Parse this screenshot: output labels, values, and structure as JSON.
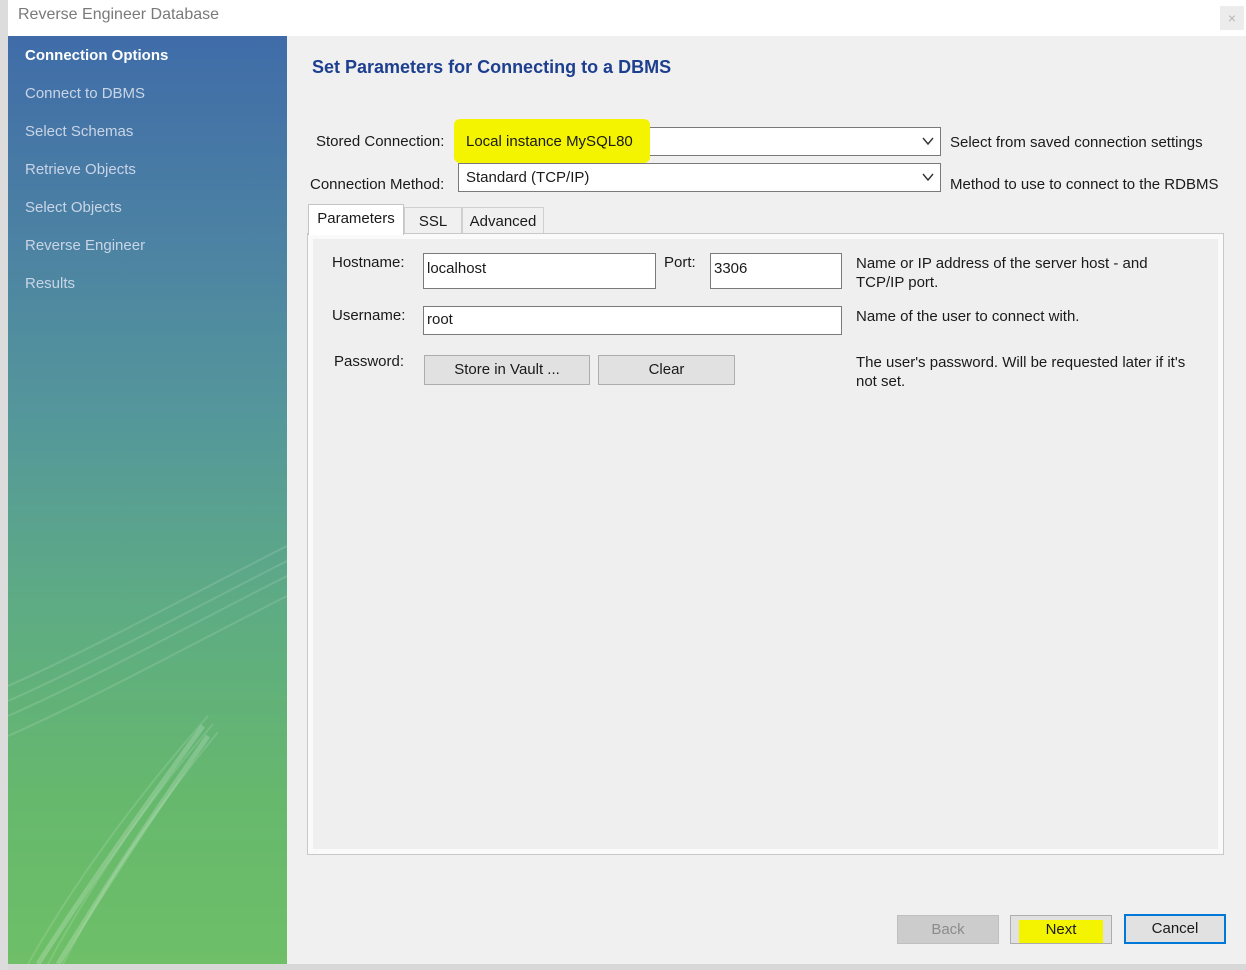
{
  "window": {
    "title": "Reverse Engineer Database",
    "close_glyph": "×"
  },
  "sidebar": {
    "steps": [
      {
        "label": "Connection Options",
        "active": true
      },
      {
        "label": "Connect to DBMS",
        "active": false
      },
      {
        "label": "Select Schemas",
        "active": false
      },
      {
        "label": "Retrieve Objects",
        "active": false
      },
      {
        "label": "Select Objects",
        "active": false
      },
      {
        "label": "Reverse Engineer",
        "active": false
      },
      {
        "label": "Results",
        "active": false
      }
    ]
  },
  "main": {
    "heading": "Set Parameters for Connecting to a DBMS",
    "stored_connection": {
      "label": "Stored Connection:",
      "value": "Local instance MySQL80",
      "hint": "Select from saved connection settings"
    },
    "connection_method": {
      "label": "Connection Method:",
      "value": "Standard (TCP/IP)",
      "hint": "Method to use to connect to the RDBMS"
    },
    "tabs": [
      {
        "label": "Parameters",
        "active": true
      },
      {
        "label": "SSL",
        "active": false
      },
      {
        "label": "Advanced",
        "active": false
      }
    ],
    "params": {
      "hostname_label": "Hostname:",
      "hostname_value": "localhost",
      "port_label": "Port:",
      "port_value": "3306",
      "hostname_hint": "Name or IP address of the server host - and TCP/IP port.",
      "username_label": "Username:",
      "username_value": "root",
      "username_hint": "Name of the user to connect with.",
      "password_label": "Password:",
      "store_vault_label": "Store in Vault ...",
      "clear_label": "Clear",
      "password_hint": "The user's password. Will be requested later if it's not set."
    }
  },
  "footer": {
    "back_label": "Back",
    "next_label": "Next",
    "cancel_label": "Cancel"
  },
  "colors": {
    "highlight": "#f4f400",
    "heading": "#1d3f8f",
    "default_button_border": "#0078d7"
  },
  "icons": {
    "dropdown": "chevron-down-icon",
    "close": "close-icon"
  }
}
